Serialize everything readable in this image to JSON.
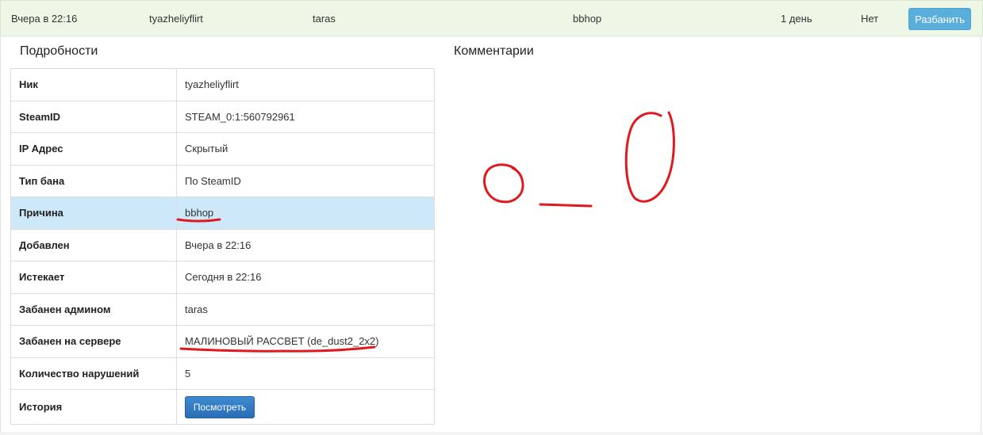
{
  "summary": {
    "date": "Вчера в 22:16",
    "nick": "tyazheliyflirt",
    "admin": "taras",
    "reason": "bbhop",
    "length": "1 день",
    "expired": "Нет",
    "unban_label": "Разбанить"
  },
  "details": {
    "title": "Подробности",
    "rows": [
      {
        "label": "Ник",
        "value": "tyazheliyflirt"
      },
      {
        "label": "SteamID",
        "value": "STEAM_0:1:560792961"
      },
      {
        "label": "IP Адрес",
        "value": "Скрытый"
      },
      {
        "label": "Тип бана",
        "value": "По SteamID"
      },
      {
        "label": "Причина",
        "value": "bbhop"
      },
      {
        "label": "Добавлен",
        "value": "Вчера в 22:16"
      },
      {
        "label": "Истекает",
        "value": "Сегодня в 22:16"
      },
      {
        "label": "Забанен админом",
        "value": "taras"
      },
      {
        "label": "Забанен на сервере",
        "value": "МАЛИНОВЫЙ РАССВЕТ (de_dust2_2x2)"
      },
      {
        "label": "Количество нарушений",
        "value": "5"
      },
      {
        "label": "История",
        "button": "Посмотреть"
      }
    ]
  },
  "comments": {
    "title": "Комментарии"
  },
  "colors": {
    "summary_bg": "#eef7e6",
    "highlight_row": "#cde8f9",
    "unban_button": "#5aaedc",
    "view_button": "#2f76bf",
    "annotation_red": "#e0191f"
  }
}
